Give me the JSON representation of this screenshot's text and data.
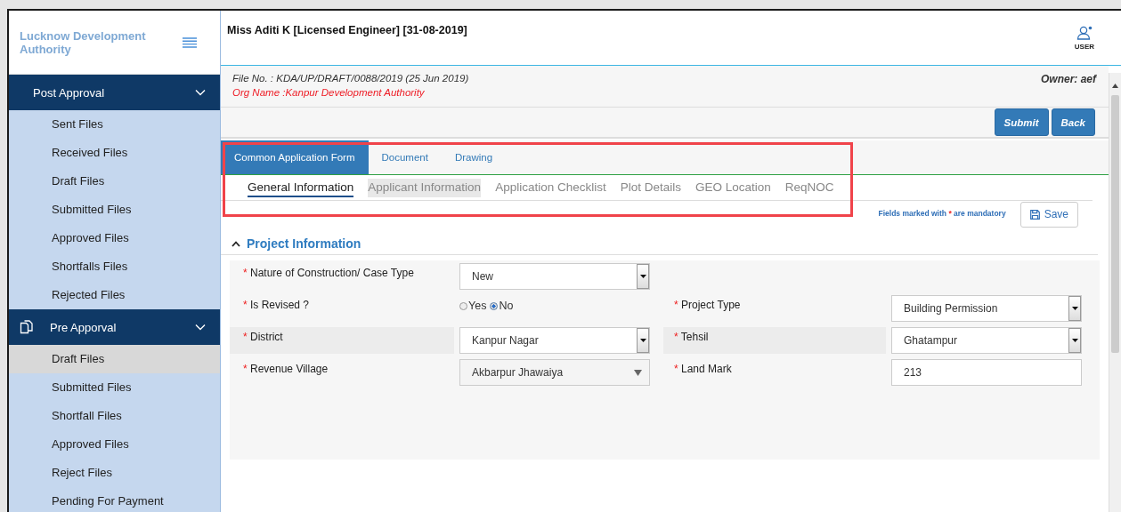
{
  "sidebar": {
    "title": "Lucknow Development Authority",
    "groups": [
      {
        "label": "Post Approval",
        "icon": false,
        "expanded": true,
        "items": [
          {
            "label": "Sent Files",
            "selected": false
          },
          {
            "label": "Received Files",
            "selected": false
          },
          {
            "label": "Draft Files",
            "selected": false
          },
          {
            "label": "Submitted Files",
            "selected": false
          },
          {
            "label": "Approved Files",
            "selected": false
          },
          {
            "label": "Shortfalls Files",
            "selected": false
          },
          {
            "label": "Rejected Files",
            "selected": false
          }
        ]
      },
      {
        "label": "Pre Apporval",
        "icon": true,
        "expanded": true,
        "items": [
          {
            "label": "Draft Files",
            "selected": true
          },
          {
            "label": "Submitted Files",
            "selected": false
          },
          {
            "label": "Shortfall Files",
            "selected": false
          },
          {
            "label": "Approved Files",
            "selected": false
          },
          {
            "label": "Reject Files",
            "selected": false
          },
          {
            "label": "Pending For Payment",
            "selected": false
          }
        ]
      }
    ]
  },
  "header": {
    "title": "Miss Aditi K [Licensed Engineer] [31-08-2019]",
    "user_label": "USER"
  },
  "file_info": {
    "file_no": "File No. : KDA/UP/DRAFT/0088/2019 (25 Jun 2019)",
    "org_name": "Org Name :Kanpur Development Authority",
    "owner": "Owner: aef"
  },
  "actions": [
    "Submit",
    "Back"
  ],
  "tabs": [
    {
      "label": "Common Application Form",
      "selected": true
    },
    {
      "label": "Document",
      "selected": false
    },
    {
      "label": "Drawing",
      "selected": false
    }
  ],
  "subtabs": [
    {
      "label": "General Information",
      "selected": true,
      "hovered": false
    },
    {
      "label": "Applicant Information",
      "selected": false,
      "hovered": true
    },
    {
      "label": "Application Checklist",
      "selected": false,
      "hovered": false
    },
    {
      "label": "Plot Details",
      "selected": false,
      "hovered": false
    },
    {
      "label": "GEO Location",
      "selected": false,
      "hovered": false
    },
    {
      "label": "ReqNOC",
      "selected": false,
      "hovered": false
    }
  ],
  "mandatory_note": {
    "before": "Fields marked with",
    "mark": "*",
    "after": "are mandatory"
  },
  "save_button": "Save",
  "section": {
    "title": "Project Information",
    "expanded": true,
    "rows": [
      {
        "fields": [
          {
            "label": "Nature of Construction/ Case Type",
            "marker": "*",
            "kind": "select",
            "value": "New"
          }
        ]
      },
      {
        "fields": [
          {
            "label": "Is Revised ?",
            "marker": "*",
            "kind": "radio",
            "options": [
              {
                "label": "Yes",
                "selected": false
              },
              {
                "label": "No",
                "selected": true
              }
            ]
          },
          {
            "label": "Project Type",
            "marker": "*",
            "kind": "select",
            "value": "Building Permission"
          }
        ]
      },
      {
        "fields": [
          {
            "label": "District",
            "marker": "*",
            "kind": "select",
            "value": "Kanpur Nagar"
          },
          {
            "label": "Tehsil",
            "marker": "*",
            "kind": "select",
            "value": "Ghatampur"
          }
        ]
      },
      {
        "fields": [
          {
            "label": "Revenue Village",
            "marker": "*",
            "kind": "combo",
            "value": "Akbarpur Jhawaiya"
          },
          {
            "label": "Land Mark",
            "marker": "*",
            "kind": "text",
            "value": "213"
          }
        ]
      }
    ]
  }
}
